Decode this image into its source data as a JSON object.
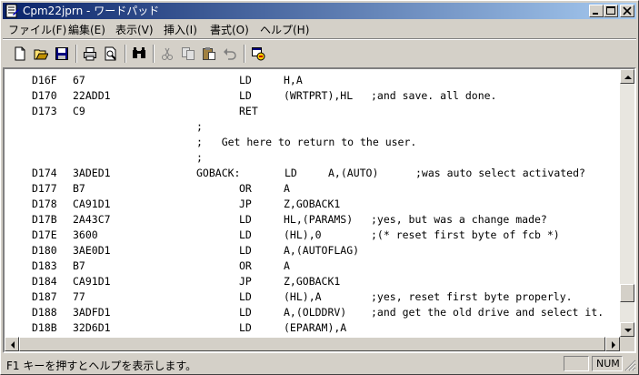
{
  "window": {
    "title": "Cpm22jprn - ワードパッド"
  },
  "menu": [
    "ファイル(F)",
    "編集(E)",
    "表示(V)",
    "挿入(I)",
    "書式(O)",
    "ヘルプ(H)"
  ],
  "toolbar_icons": [
    "new-icon",
    "open-icon",
    "save-icon",
    "print-icon",
    "print-preview-icon",
    "find-icon",
    "cut-icon",
    "copy-icon",
    "paste-icon",
    "undo-icon",
    "insert-object-icon"
  ],
  "document": {
    "lines": [
      {
        "addr": "D16F",
        "hex": "67",
        "label": "",
        "op": "LD",
        "arg": "H,A",
        "comment": ""
      },
      {
        "addr": "D170",
        "hex": "22ADD1",
        "label": "",
        "op": "LD",
        "arg": "(WRTPRT),HL",
        "comment": ";and save. all done."
      },
      {
        "addr": "D173",
        "hex": "C9",
        "label": "",
        "op": "RET",
        "arg": "",
        "comment": ""
      },
      {
        "addr": "",
        "hex": "",
        "label": ";",
        "op": "",
        "arg": "",
        "comment": ""
      },
      {
        "addr": "",
        "hex": "",
        "label": ";   Get here to return to the user.",
        "op": "",
        "arg": "",
        "comment": ""
      },
      {
        "addr": "",
        "hex": "",
        "label": ";",
        "op": "",
        "arg": "",
        "comment": ""
      },
      {
        "addr": "D174",
        "hex": "3ADED1",
        "label": "GOBACK:",
        "op": "LD",
        "arg": "A,(AUTO)",
        "comment": ";was auto select activated?"
      },
      {
        "addr": "D177",
        "hex": "B7",
        "label": "",
        "op": "OR",
        "arg": "A",
        "comment": ""
      },
      {
        "addr": "D178",
        "hex": "CA91D1",
        "label": "",
        "op": "JP",
        "arg": "Z,GOBACK1",
        "comment": ""
      },
      {
        "addr": "D17B",
        "hex": "2A43C7",
        "label": "",
        "op": "LD",
        "arg": "HL,(PARAMS)",
        "comment": ";yes, but was a change made?"
      },
      {
        "addr": "D17E",
        "hex": "3600",
        "label": "",
        "op": "LD",
        "arg": "(HL),0",
        "comment": ";(* reset first byte of fcb *)"
      },
      {
        "addr": "D180",
        "hex": "3AE0D1",
        "label": "",
        "op": "LD",
        "arg": "A,(AUTOFLAG)",
        "comment": ""
      },
      {
        "addr": "D183",
        "hex": "B7",
        "label": "",
        "op": "OR",
        "arg": "A",
        "comment": ""
      },
      {
        "addr": "D184",
        "hex": "CA91D1",
        "label": "",
        "op": "JP",
        "arg": "Z,GOBACK1",
        "comment": ""
      },
      {
        "addr": "D187",
        "hex": "77",
        "label": "",
        "op": "LD",
        "arg": "(HL),A",
        "comment": ";yes, reset first byte properly."
      },
      {
        "addr": "D188",
        "hex": "3ADFD1",
        "label": "",
        "op": "LD",
        "arg": "A,(OLDDRV)",
        "comment": ";and get the old drive and select it."
      },
      {
        "addr": "D18B",
        "hex": "32D6D1",
        "label": "",
        "op": "LD",
        "arg": "(EPARAM),A",
        "comment": ""
      }
    ]
  },
  "status": {
    "text": "F1 キーを押すとヘルプを表示します。",
    "num": "NUM"
  }
}
